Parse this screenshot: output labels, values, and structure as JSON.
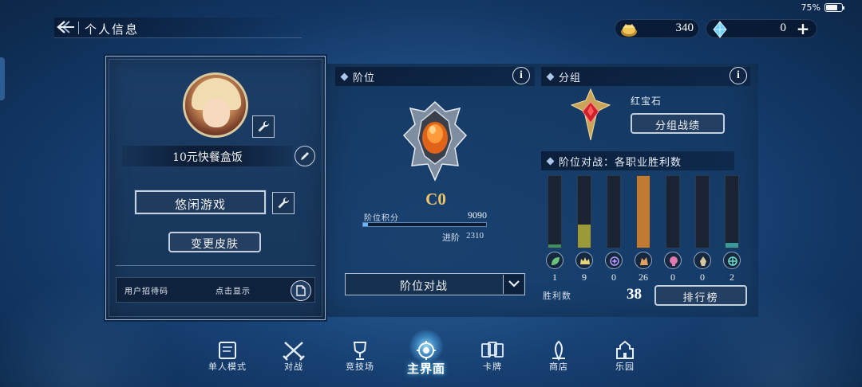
{
  "status": {
    "battery": "75%",
    "battery_level": 0.75
  },
  "header": {
    "title": "个人信息"
  },
  "currency": {
    "gold": "340",
    "crystal": "0"
  },
  "profile": {
    "player_name": "10元快餐盒饭",
    "title": "悠闲游戏",
    "change_skin_label": "变更皮肤",
    "invite_code_label": "用户招待码",
    "invite_code_action": "点击显示"
  },
  "rank": {
    "section_title": "阶位",
    "rank_letter": "C0",
    "points_label": "阶位积分",
    "points_value": "9090",
    "points_progress": 0.04,
    "advance_label": "进阶",
    "advance_value": "2310",
    "mode_selected": "阶位对战"
  },
  "group": {
    "section_title": "分组",
    "group_name": "红宝石",
    "group_record_label": "分组战绩"
  },
  "class_wins": {
    "title": "阶位对战：各职业胜利数",
    "classes": [
      {
        "icon": "elf-leaf-icon",
        "wins": "1",
        "fill": 0.04,
        "color": "#3f8f62"
      },
      {
        "icon": "royal-crown-icon",
        "wins": "9",
        "fill": 0.32,
        "color": "#9a9a3a"
      },
      {
        "icon": "witch-star-icon",
        "wins": "0",
        "fill": 0,
        "color": "#555"
      },
      {
        "icon": "dragon-icon",
        "wins": "26",
        "fill": 1.0,
        "color": "#c07a32"
      },
      {
        "icon": "necro-skull-icon",
        "wins": "0",
        "fill": 0,
        "color": "#555"
      },
      {
        "icon": "vampire-icon",
        "wins": "0",
        "fill": 0,
        "color": "#555"
      },
      {
        "icon": "bishop-icon",
        "wins": "2",
        "fill": 0.07,
        "color": "#3a9a9a"
      }
    ],
    "wins_label": "胜利数",
    "wins_total": "38",
    "leaderboard_label": "排行榜"
  },
  "nav": [
    {
      "label": "单人模式",
      "icon": "book-icon"
    },
    {
      "label": "对战",
      "icon": "crossed-swords-icon"
    },
    {
      "label": "竞技场",
      "icon": "trophy-icon"
    },
    {
      "label": "主界面",
      "icon": "home-crest-icon",
      "active": true
    },
    {
      "label": "卡牌",
      "icon": "cards-icon"
    },
    {
      "label": "商店",
      "icon": "shop-icon"
    },
    {
      "label": "乐园",
      "icon": "castle-icon"
    }
  ]
}
